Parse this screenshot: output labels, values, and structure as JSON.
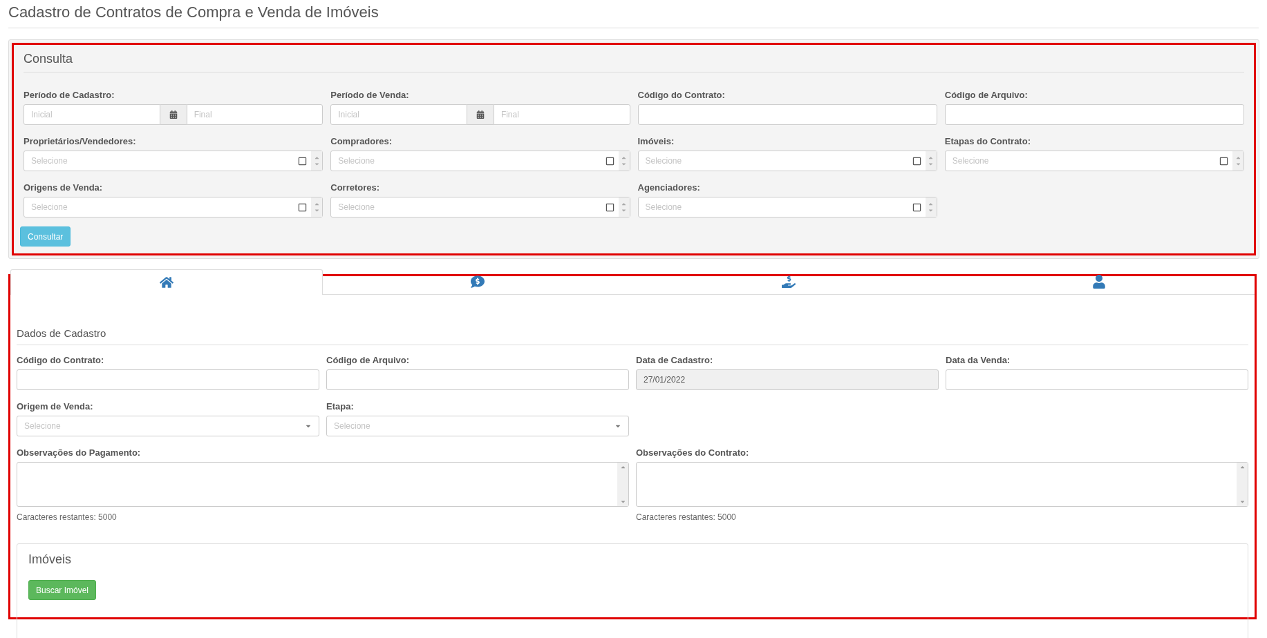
{
  "page_title": "Cadastro de Contratos de Compra e Venda de Imóveis",
  "consulta": {
    "title": "Consulta",
    "fields": [
      {
        "kind": "daterange",
        "label": "Período de Cadastro:",
        "placeholders": [
          "Inicial",
          "Final"
        ]
      },
      {
        "kind": "daterange",
        "label": "Período de Venda:",
        "placeholders": [
          "Inicial",
          "Final"
        ]
      },
      {
        "kind": "text",
        "label": "Código do Contrato:"
      },
      {
        "kind": "text",
        "label": "Código de Arquivo:"
      },
      {
        "kind": "multiselect",
        "label": "Proprietários/Vendedores:",
        "placeholder": "Selecione"
      },
      {
        "kind": "multiselect",
        "label": "Compradores:",
        "placeholder": "Selecione"
      },
      {
        "kind": "multiselect",
        "label": "Imóveis:",
        "placeholder": "Selecione"
      },
      {
        "kind": "multiselect",
        "label": "Etapas do Contrato:",
        "placeholder": "Selecione"
      },
      {
        "kind": "multiselect",
        "label": "Origens de Venda:",
        "placeholder": "Selecione"
      },
      {
        "kind": "multiselect",
        "label": "Corretores:",
        "placeholder": "Selecione"
      },
      {
        "kind": "multiselect",
        "label": "Agenciadores:",
        "placeholder": "Selecione"
      }
    ],
    "button": "Consultar"
  },
  "tabs": [
    {
      "selected": true
    },
    {
      "selected": false
    },
    {
      "selected": false
    },
    {
      "selected": false
    }
  ],
  "cadastro": {
    "title": "Dados de Cadastro",
    "fields": [
      {
        "kind": "text",
        "label": "Código do Contrato:",
        "disabled": false
      },
      {
        "kind": "text",
        "label": "Código de Arquivo:",
        "disabled": false
      },
      {
        "kind": "text",
        "label": "Data de Cadastro:",
        "value": "27/01/2022",
        "disabled": true
      },
      {
        "kind": "text",
        "label": "Data da Venda:",
        "disabled": false
      },
      {
        "kind": "select",
        "label": "Origem de Venda:",
        "placeholder": "Selecione"
      },
      {
        "kind": "select",
        "label": "Etapa:",
        "placeholder": "Selecione"
      }
    ],
    "textareas": [
      {
        "label": "Observações do Pagamento:",
        "counter": "Caracteres restantes: 5000"
      },
      {
        "label": "Observações do Contrato:",
        "counter": "Caracteres restantes: 5000"
      }
    ],
    "imoveis": {
      "title": "Imóveis",
      "button": "Buscar Imóvel"
    }
  }
}
